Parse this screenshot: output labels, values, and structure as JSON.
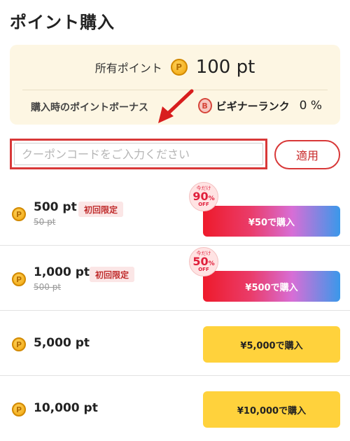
{
  "header": {
    "title": "ポイント購入"
  },
  "balance": {
    "label": "所有ポイント",
    "value": "100 pt",
    "coin_icon": "coin-icon",
    "coin_letter": "P"
  },
  "bonus": {
    "label": "購入時のポイントボーナス",
    "rank_icon": "rank-b-icon",
    "rank_letter": "B",
    "rank_name": "ビギナーランク",
    "percent": "0 %"
  },
  "coupon": {
    "placeholder": "クーポンコードをご入力ください",
    "value": "",
    "apply_label": "適用"
  },
  "plans": [
    {
      "amount": "500 pt",
      "original": "50 pt",
      "badge": "初回限定",
      "price_label": "¥50で購入",
      "sale": true,
      "discount": {
        "today": "今だけ",
        "value": "90",
        "unit": "%",
        "off": "OFF"
      }
    },
    {
      "amount": "1,000 pt",
      "original": "500 pt",
      "badge": "初回限定",
      "price_label": "¥500で購入",
      "sale": true,
      "discount": {
        "today": "今だけ",
        "value": "50",
        "unit": "%",
        "off": "OFF"
      }
    },
    {
      "amount": "5,000 pt",
      "price_label": "¥5,000で購入",
      "sale": false
    },
    {
      "amount": "10,000 pt",
      "price_label": "¥10,000で購入",
      "sale": false
    }
  ],
  "colors": {
    "accent_red": "#d83838",
    "card_background": "#fdf6e3",
    "regular_button": "#ffd23c",
    "sale_gradient": [
      "#ee1a2b",
      "#ea3c6a",
      "#d76ed6",
      "#3a98ea"
    ]
  }
}
